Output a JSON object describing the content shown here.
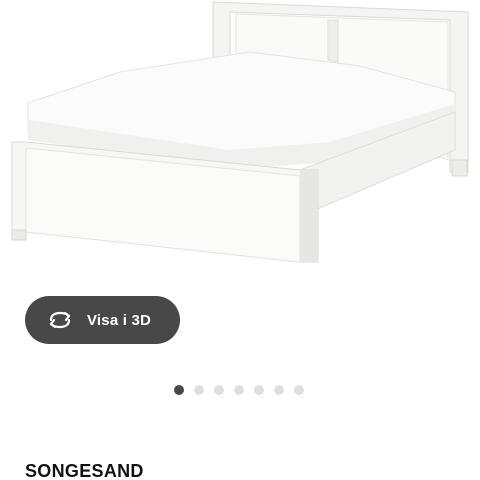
{
  "product": {
    "name": "SONGESAND",
    "image_icon": "bed-image"
  },
  "view_3d": {
    "label": "Visa i 3D",
    "icon": "rotate-3d-icon"
  },
  "carousel": {
    "total": 7,
    "active_index": 0
  },
  "colors": {
    "button_bg": "#484848",
    "dot_active": "#484848",
    "dot_inactive": "#dfdfdf"
  }
}
